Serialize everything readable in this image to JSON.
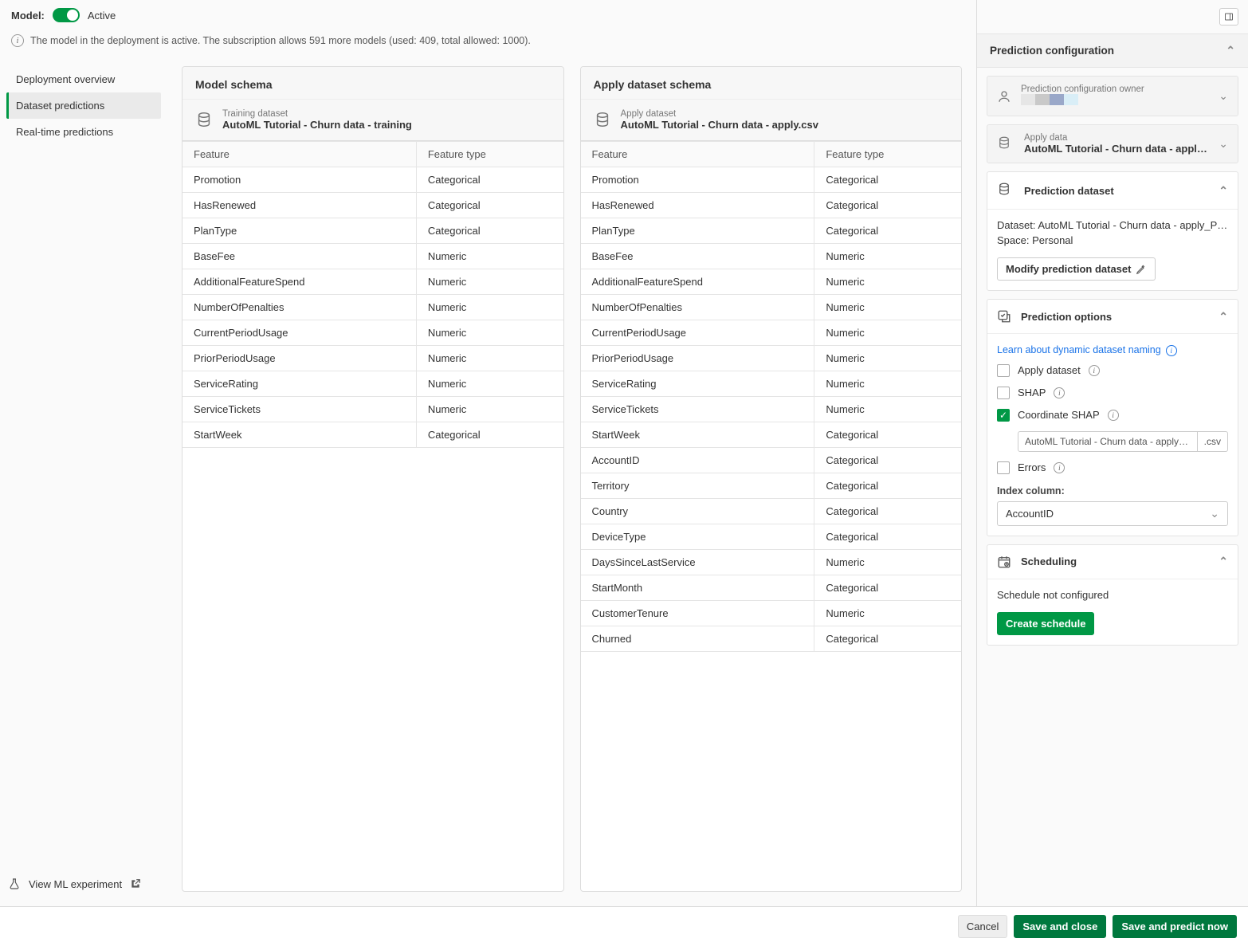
{
  "header": {
    "model_label": "Model:",
    "active_label": "Active",
    "info_text": "The model in the deployment is active. The subscription allows 591 more models (used: 409, total allowed: 1000)."
  },
  "sidebar": {
    "items": [
      {
        "label": "Deployment overview"
      },
      {
        "label": "Dataset predictions"
      },
      {
        "label": "Real-time predictions"
      }
    ],
    "footer_label": "View ML experiment"
  },
  "model_schema": {
    "title": "Model schema",
    "dataset_sub": "Training dataset",
    "dataset_name": "AutoML Tutorial - Churn data - training",
    "col_feature": "Feature",
    "col_type": "Feature type",
    "rows": [
      {
        "feature": "Promotion",
        "type": "Categorical"
      },
      {
        "feature": "HasRenewed",
        "type": "Categorical"
      },
      {
        "feature": "PlanType",
        "type": "Categorical"
      },
      {
        "feature": "BaseFee",
        "type": "Numeric"
      },
      {
        "feature": "AdditionalFeatureSpend",
        "type": "Numeric"
      },
      {
        "feature": "NumberOfPenalties",
        "type": "Numeric"
      },
      {
        "feature": "CurrentPeriodUsage",
        "type": "Numeric"
      },
      {
        "feature": "PriorPeriodUsage",
        "type": "Numeric"
      },
      {
        "feature": "ServiceRating",
        "type": "Numeric"
      },
      {
        "feature": "ServiceTickets",
        "type": "Numeric"
      },
      {
        "feature": "StartWeek",
        "type": "Categorical"
      }
    ]
  },
  "apply_schema": {
    "title": "Apply dataset schema",
    "dataset_sub": "Apply dataset",
    "dataset_name": "AutoML Tutorial - Churn data - apply.csv",
    "col_feature": "Feature",
    "col_type": "Feature type",
    "rows": [
      {
        "feature": "Promotion",
        "type": "Categorical"
      },
      {
        "feature": "HasRenewed",
        "type": "Categorical"
      },
      {
        "feature": "PlanType",
        "type": "Categorical"
      },
      {
        "feature": "BaseFee",
        "type": "Numeric"
      },
      {
        "feature": "AdditionalFeatureSpend",
        "type": "Numeric"
      },
      {
        "feature": "NumberOfPenalties",
        "type": "Numeric"
      },
      {
        "feature": "CurrentPeriodUsage",
        "type": "Numeric"
      },
      {
        "feature": "PriorPeriodUsage",
        "type": "Numeric"
      },
      {
        "feature": "ServiceRating",
        "type": "Numeric"
      },
      {
        "feature": "ServiceTickets",
        "type": "Numeric"
      },
      {
        "feature": "StartWeek",
        "type": "Categorical"
      },
      {
        "feature": "AccountID",
        "type": "Categorical"
      },
      {
        "feature": "Territory",
        "type": "Categorical"
      },
      {
        "feature": "Country",
        "type": "Categorical"
      },
      {
        "feature": "DeviceType",
        "type": "Categorical"
      },
      {
        "feature": "DaysSinceLastService",
        "type": "Numeric"
      },
      {
        "feature": "StartMonth",
        "type": "Categorical"
      },
      {
        "feature": "CustomerTenure",
        "type": "Numeric"
      },
      {
        "feature": "Churned",
        "type": "Categorical"
      }
    ]
  },
  "right": {
    "title": "Prediction configuration",
    "owner": {
      "sub": "Prediction configuration owner"
    },
    "apply_data": {
      "sub": "Apply data",
      "val": "AutoML Tutorial - Churn data - apply.csv"
    },
    "pred_dataset": {
      "head": "Prediction dataset",
      "dataset_label": "Dataset:",
      "dataset_value": "AutoML Tutorial - Churn data - apply_Predict…",
      "space_label": "Space:",
      "space_value": "Personal",
      "modify_btn": "Modify prediction dataset"
    },
    "options": {
      "head": "Prediction options",
      "learn_link": "Learn about dynamic dataset naming",
      "apply_dataset": "Apply dataset",
      "shap": "SHAP",
      "coord_shap": "Coordinate SHAP",
      "coord_value": "AutoML Tutorial - Churn data - apply_Predictic",
      "coord_ext": ".csv",
      "errors": "Errors",
      "index_label": "Index column:",
      "index_value": "AccountID"
    },
    "scheduling": {
      "head": "Scheduling",
      "status": "Schedule not configured",
      "btn": "Create schedule"
    }
  },
  "footer": {
    "cancel": "Cancel",
    "save_close": "Save and close",
    "save_predict": "Save and predict now"
  }
}
